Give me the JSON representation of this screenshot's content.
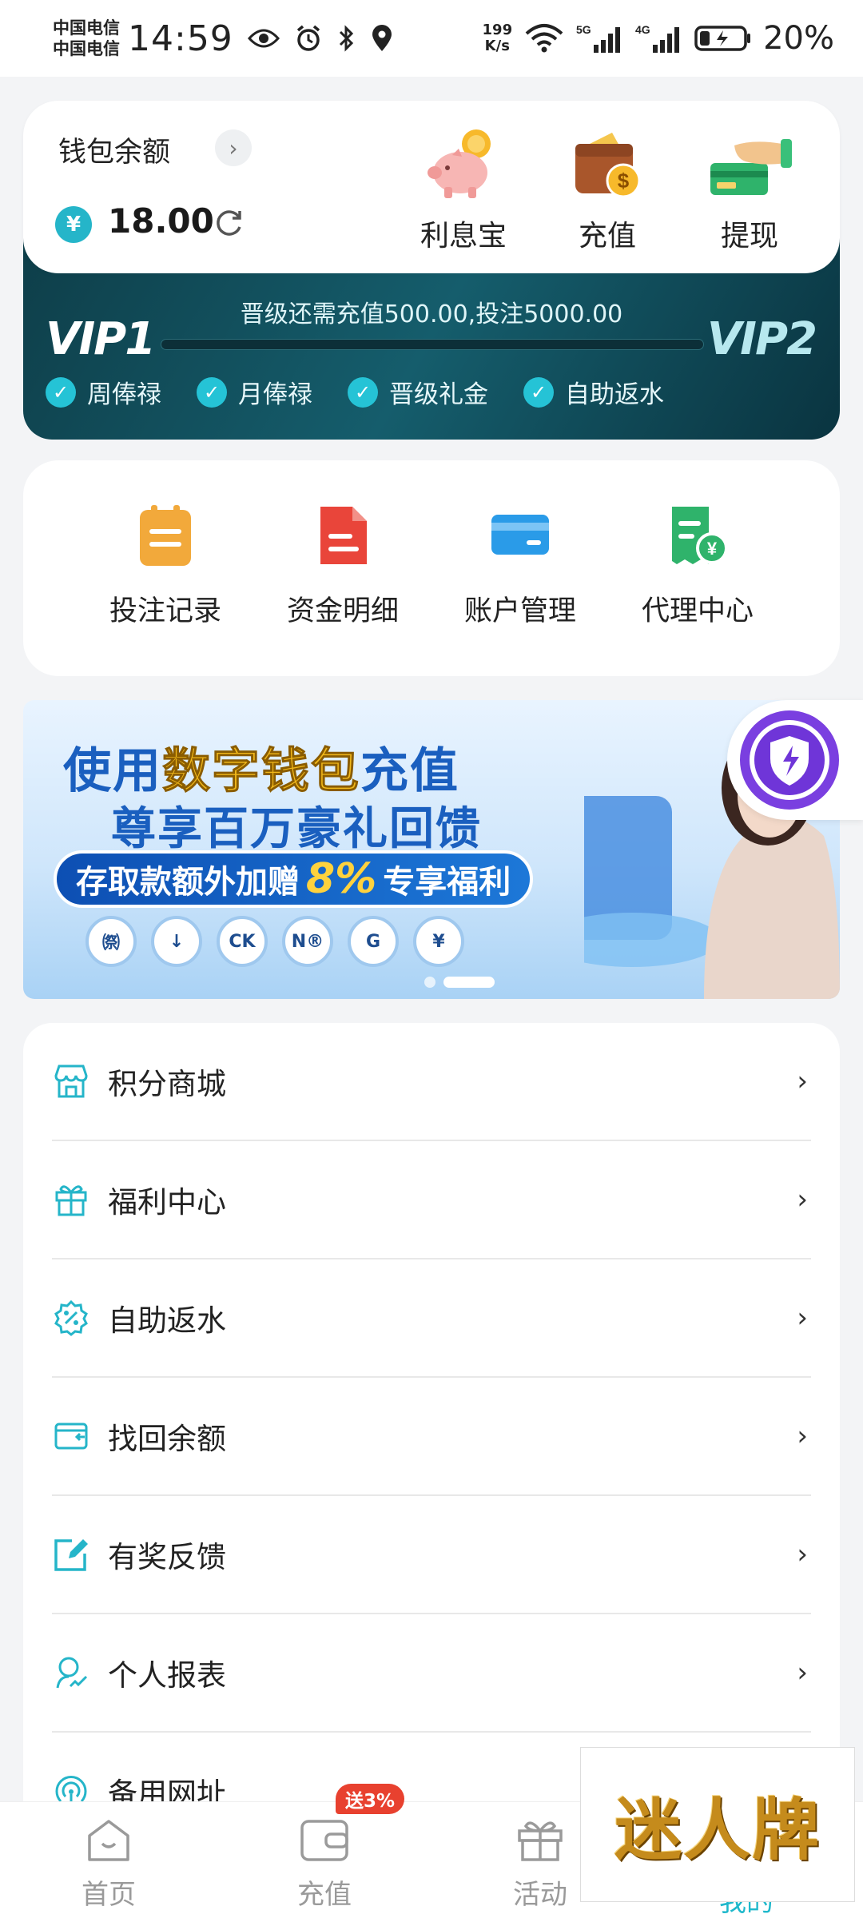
{
  "status_bar": {
    "carrier_1": "中国电信",
    "carrier_2": "中国电信",
    "time": "14:59",
    "net_speed_value": "199",
    "net_speed_unit": "K/s",
    "battery": "20%"
  },
  "wallet": {
    "title": "钱包余额",
    "balance": "18.00",
    "actions": [
      {
        "label": "利息宝",
        "icon": "piggy-bank-icon"
      },
      {
        "label": "充值",
        "icon": "wallet-coin-icon"
      },
      {
        "label": "提现",
        "icon": "hand-card-icon"
      }
    ]
  },
  "vip": {
    "notice": "晋级还需充值500.00,投注5000.00",
    "current_level": "VIP1",
    "next_level": "VIP2",
    "progress": 0,
    "perks": [
      "周俸禄",
      "月俸禄",
      "晋级礼金",
      "自助返水"
    ]
  },
  "quick_menu": [
    {
      "label": "投注记录",
      "icon": "clipboard-icon",
      "color": "#f2a93b"
    },
    {
      "label": "资金明细",
      "icon": "document-icon",
      "color": "#e9453a"
    },
    {
      "label": "账户管理",
      "icon": "card-icon",
      "color": "#2a9be8"
    },
    {
      "label": "代理中心",
      "icon": "receipt-yen-icon",
      "color": "#2fb36b"
    }
  ],
  "promo": {
    "line1_a": "使用",
    "line1_hl": "数字钱包",
    "line1_b": "充值",
    "line2": "尊享百万豪礼回馈",
    "pill_a": "存取款额外加赠",
    "pill_pct": "8%",
    "pill_b": "专享福利",
    "coins": [
      "㉀",
      "↓",
      "CK",
      "N®",
      "G",
      "¥"
    ]
  },
  "menu_list": [
    {
      "label": "积分商城",
      "icon": "store-icon"
    },
    {
      "label": "福利中心",
      "icon": "gift-icon"
    },
    {
      "label": "自助返水",
      "icon": "percent-badge-icon"
    },
    {
      "label": "找回余额",
      "icon": "wallet-return-icon"
    },
    {
      "label": "有奖反馈",
      "icon": "edit-icon"
    },
    {
      "label": "个人报表",
      "icon": "person-chart-icon"
    },
    {
      "label": "备用网址",
      "icon": "signal-icon"
    }
  ],
  "bottom_nav": [
    {
      "label": "首页",
      "icon": "home-icon"
    },
    {
      "label": "充值",
      "icon": "wallet-icon"
    },
    {
      "label": "活动",
      "icon": "gift-nav-icon"
    },
    {
      "label": "我的",
      "icon": "profile-icon"
    }
  ],
  "nav_badge": "送3%",
  "watermark": "迷人牌",
  "colors": {
    "accent": "#25b5c9",
    "vip_bg": "#0f4855",
    "badge": "#e8412f"
  }
}
